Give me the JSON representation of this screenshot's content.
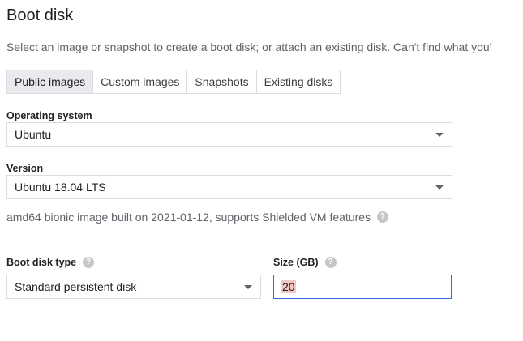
{
  "section": {
    "title": "Boot disk",
    "description": "Select an image or snapshot to create a boot disk; or attach an existing disk. Can't find what you'"
  },
  "tabs": [
    {
      "label": "Public images",
      "active": true
    },
    {
      "label": "Custom images",
      "active": false
    },
    {
      "label": "Snapshots",
      "active": false
    },
    {
      "label": "Existing disks",
      "active": false
    }
  ],
  "os": {
    "label": "Operating system",
    "value": "Ubuntu"
  },
  "version": {
    "label": "Version",
    "value": "Ubuntu 18.04 LTS",
    "note": "amd64 bionic image built on 2021-01-12, supports Shielded VM features"
  },
  "disk_type": {
    "label": "Boot disk type",
    "value": "Standard persistent disk"
  },
  "size": {
    "label": "Size (GB)",
    "value": "20"
  },
  "icons": {
    "help": "help-icon",
    "dropdown": "dropdown-caret-icon"
  }
}
